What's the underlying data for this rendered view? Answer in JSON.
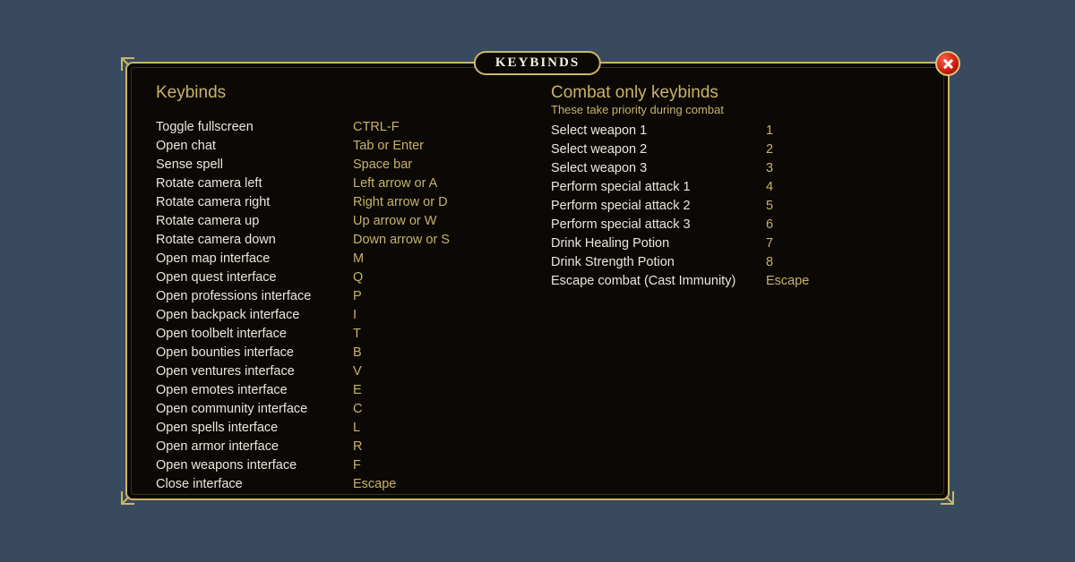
{
  "title": "KEYBINDS",
  "left": {
    "heading": "Keybinds",
    "items": [
      {
        "action": "Toggle fullscreen",
        "key": "CTRL-F"
      },
      {
        "action": "Open chat",
        "key": "Tab or Enter"
      },
      {
        "action": "Sense spell",
        "key": "Space bar"
      },
      {
        "action": "Rotate camera left",
        "key": "Left arrow or A"
      },
      {
        "action": "Rotate camera right",
        "key": "Right arrow or D"
      },
      {
        "action": "Rotate camera up",
        "key": "Up arrow or W"
      },
      {
        "action": "Rotate camera down",
        "key": "Down arrow or S"
      },
      {
        "action": "Open map interface",
        "key": "M"
      },
      {
        "action": "Open quest interface",
        "key": "Q"
      },
      {
        "action": "Open professions interface",
        "key": "P"
      },
      {
        "action": "Open backpack interface",
        "key": "I"
      },
      {
        "action": "Open toolbelt interface",
        "key": "T"
      },
      {
        "action": "Open bounties interface",
        "key": "B"
      },
      {
        "action": "Open ventures interface",
        "key": "V"
      },
      {
        "action": "Open emotes interface",
        "key": "E"
      },
      {
        "action": "Open community interface",
        "key": "C"
      },
      {
        "action": "Open spells interface",
        "key": "L"
      },
      {
        "action": "Open armor interface",
        "key": "R"
      },
      {
        "action": "Open weapons interface",
        "key": "F"
      },
      {
        "action": "Close interface",
        "key": "Escape"
      }
    ]
  },
  "right": {
    "heading": "Combat only keybinds",
    "subheading": "These take priority during combat",
    "items": [
      {
        "action": "Select weapon 1",
        "key": "1"
      },
      {
        "action": "Select weapon 2",
        "key": "2"
      },
      {
        "action": "Select weapon 3",
        "key": "3"
      },
      {
        "action": "Perform special attack 1",
        "key": "4"
      },
      {
        "action": "Perform special attack 2",
        "key": "5"
      },
      {
        "action": "Perform special attack 3",
        "key": "6"
      },
      {
        "action": "Drink Healing Potion",
        "key": "7"
      },
      {
        "action": "Drink Strength Potion",
        "key": "8"
      },
      {
        "action": "Escape combat (Cast Immunity)",
        "key": "Escape"
      }
    ]
  }
}
